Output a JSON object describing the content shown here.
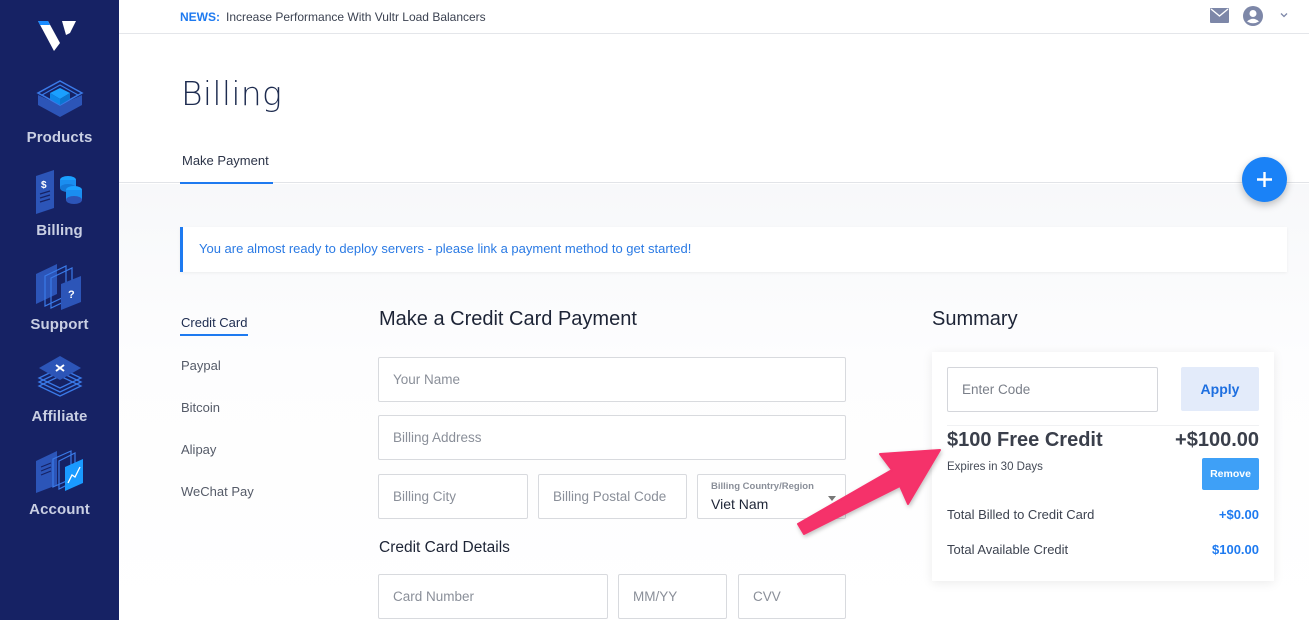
{
  "sidebar": {
    "logo": "vultr-logo",
    "items": [
      {
        "label": "Products",
        "icon": "products-icon"
      },
      {
        "label": "Billing",
        "icon": "billing-icon"
      },
      {
        "label": "Support",
        "icon": "support-icon"
      },
      {
        "label": "Affiliate",
        "icon": "affiliate-icon"
      },
      {
        "label": "Account",
        "icon": "account-icon"
      }
    ]
  },
  "topbar": {
    "news_label": "NEWS:",
    "news_text": "Increase Performance With Vultr Load Balancers",
    "icons": [
      "mail-icon",
      "user-icon",
      "chevron-down-icon"
    ]
  },
  "header": {
    "title": "Billing",
    "tabs": [
      {
        "label": "Make Payment",
        "active": true
      }
    ],
    "fab_icon": "plus-icon"
  },
  "alert": {
    "text": "You are almost ready to deploy servers - please link a payment method to get started!"
  },
  "payment_methods": [
    {
      "label": "Credit Card",
      "active": true
    },
    {
      "label": "Paypal"
    },
    {
      "label": "Bitcoin"
    },
    {
      "label": "Alipay"
    },
    {
      "label": "WeChat Pay"
    }
  ],
  "form": {
    "title": "Make a Credit Card Payment",
    "name_placeholder": "Your Name",
    "address_placeholder": "Billing Address",
    "city_placeholder": "Billing City",
    "postal_placeholder": "Billing Postal Code",
    "country_label": "Billing Country/Region",
    "country_value": "Viet Nam",
    "card_section_title": "Credit Card Details",
    "card_number_placeholder": "Card Number",
    "expiry_placeholder": "MM/YY",
    "cvv_placeholder": "CVV"
  },
  "summary": {
    "title": "Summary",
    "code_placeholder": "Enter Code",
    "apply_label": "Apply",
    "credit_name": "$100 Free Credit",
    "credit_amount": "+$100.00",
    "credit_expiry": "Expires in 30 Days",
    "remove_label": "Remove",
    "rows": [
      {
        "label": "Total Billed to Credit Card",
        "value": "+$0.00"
      },
      {
        "label": "Total Available Credit",
        "value": "$100.00"
      }
    ]
  },
  "colors": {
    "sidebar_bg": "#162264",
    "accent": "#1e7af0",
    "annotation_arrow": "#f5306b"
  }
}
